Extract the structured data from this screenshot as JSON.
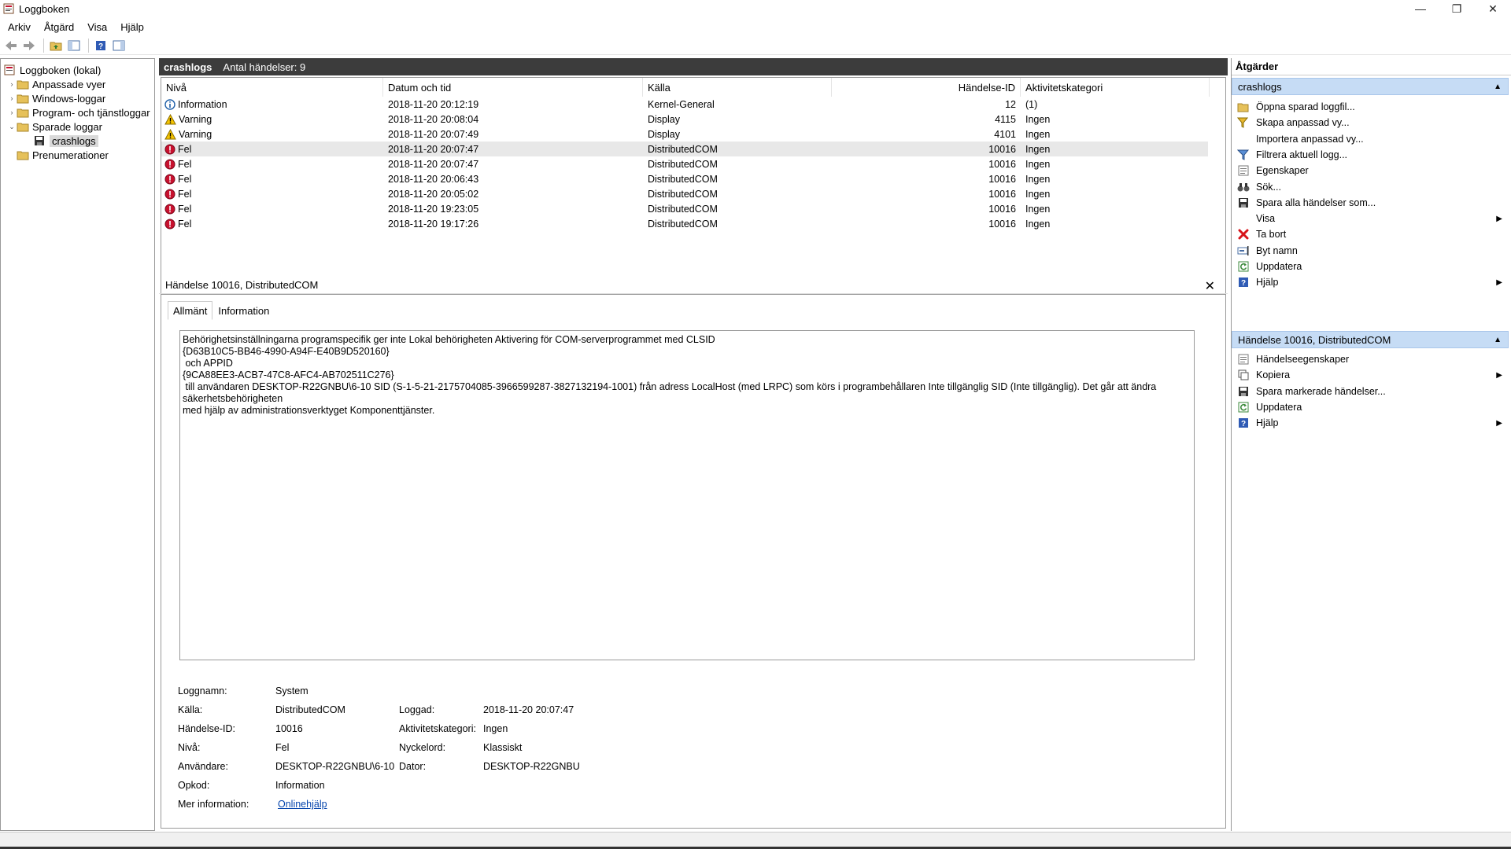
{
  "window": {
    "title": "Loggboken"
  },
  "menu": [
    "Arkiv",
    "Åtgärd",
    "Visa",
    "Hjälp"
  ],
  "tree": [
    {
      "label": "Loggboken (lokal)",
      "level": 0,
      "expander": "",
      "icon": "event-viewer-icon"
    },
    {
      "label": "Anpassade vyer",
      "level": 1,
      "expander": "›",
      "icon": "folder-icon"
    },
    {
      "label": "Windows-loggar",
      "level": 1,
      "expander": "›",
      "icon": "folder-icon"
    },
    {
      "label": "Program- och tjänstloggar",
      "level": 1,
      "expander": "›",
      "icon": "folder-icon"
    },
    {
      "label": "Sparade loggar",
      "level": 1,
      "expander": "⌄",
      "icon": "folder-icon"
    },
    {
      "label": "crashlogs",
      "level": 2,
      "expander": "",
      "icon": "saved-log-icon",
      "selected": true
    },
    {
      "label": "Prenumerationer",
      "level": 1,
      "expander": "",
      "icon": "folder-icon"
    }
  ],
  "list": {
    "name": "crashlogs",
    "count_label": "Antal händelser: 9",
    "columns": [
      "Nivå",
      "Datum och tid",
      "Källa",
      "Händelse-ID",
      "Aktivitetskategori"
    ],
    "rows": [
      {
        "level": "Information",
        "type": "info",
        "datetime": "2018-11-20 20:12:19",
        "source": "Kernel-General",
        "id": "12",
        "category": "(1)"
      },
      {
        "level": "Varning",
        "type": "warning",
        "datetime": "2018-11-20 20:08:04",
        "source": "Display",
        "id": "4115",
        "category": "Ingen"
      },
      {
        "level": "Varning",
        "type": "warning",
        "datetime": "2018-11-20 20:07:49",
        "source": "Display",
        "id": "4101",
        "category": "Ingen"
      },
      {
        "level": "Fel",
        "type": "error",
        "datetime": "2018-11-20 20:07:47",
        "source": "DistributedCOM",
        "id": "10016",
        "category": "Ingen",
        "selected": true
      },
      {
        "level": "Fel",
        "type": "error",
        "datetime": "2018-11-20 20:07:47",
        "source": "DistributedCOM",
        "id": "10016",
        "category": "Ingen"
      },
      {
        "level": "Fel",
        "type": "error",
        "datetime": "2018-11-20 20:06:43",
        "source": "DistributedCOM",
        "id": "10016",
        "category": "Ingen"
      },
      {
        "level": "Fel",
        "type": "error",
        "datetime": "2018-11-20 20:05:02",
        "source": "DistributedCOM",
        "id": "10016",
        "category": "Ingen"
      },
      {
        "level": "Fel",
        "type": "error",
        "datetime": "2018-11-20 19:23:05",
        "source": "DistributedCOM",
        "id": "10016",
        "category": "Ingen"
      },
      {
        "level": "Fel",
        "type": "error",
        "datetime": "2018-11-20 19:17:26",
        "source": "DistributedCOM",
        "id": "10016",
        "category": "Ingen"
      }
    ]
  },
  "detail": {
    "title": "Händelse 10016, DistributedCOM",
    "tabs": [
      "Allmänt",
      "Information"
    ],
    "message": [
      "Behörighetsinställningarna programspecifik ger inte Lokal behörigheten Aktivering för COM-serverprogrammet med CLSID",
      "{D63B10C5-BB46-4990-A94F-E40B9D520160}",
      " och APPID",
      "{9CA88EE3-ACB7-47C8-AFC4-AB702511C276}",
      " till användaren DESKTOP-R22GNBU\\6-10 SID (S-1-5-21-2175704085-3966599287-3827132194-1001) från adress LocalHost (med LRPC) som körs i programbehållaren Inte tillgänglig SID (Inte tillgänglig). Det går att ändra säkerhetsbehörigheten",
      "med hjälp av administrationsverktyget Komponenttjänster."
    ],
    "fields": {
      "logname_label": "Loggnamn:",
      "logname": "System",
      "source_label": "Källa:",
      "source": "DistributedCOM",
      "logged_label": "Loggad:",
      "logged": "2018-11-20 20:07:47",
      "eventid_label": "Händelse-ID:",
      "eventid": "10016",
      "category_label": "Aktivitetskategori:",
      "category": "Ingen",
      "level_label": "Nivå:",
      "level": "Fel",
      "keywords_label": "Nyckelord:",
      "keywords": "Klassiskt",
      "user_label": "Användare:",
      "user": "DESKTOP-R22GNBU\\6-10",
      "computer_label": "Dator:",
      "computer": "DESKTOP-R22GNBU",
      "opcode_label": "Opkod:",
      "opcode": "Information",
      "moreinfo_label": "Mer information:",
      "moreinfo_link": "Onlinehjälp"
    }
  },
  "actions": {
    "title": "Åtgärder",
    "section1": "crashlogs",
    "items1": [
      {
        "label": "Öppna sparad loggfil...",
        "icon": "open-folder-icon"
      },
      {
        "label": "Skapa anpassad vy...",
        "icon": "filter-add-icon"
      },
      {
        "label": "Importera anpassad vy...",
        "icon": ""
      },
      {
        "label": "Filtrera aktuell logg...",
        "icon": "filter-icon"
      },
      {
        "label": "Egenskaper",
        "icon": "properties-icon"
      },
      {
        "label": "Sök...",
        "icon": "binoculars-icon"
      },
      {
        "label": "Spara alla händelser som...",
        "icon": "save-icon"
      },
      {
        "label": "Visa",
        "icon": "",
        "submenu": true
      },
      {
        "label": "Ta bort",
        "icon": "delete-icon"
      },
      {
        "label": "Byt namn",
        "icon": "rename-icon"
      },
      {
        "label": "Uppdatera",
        "icon": "refresh-icon"
      },
      {
        "label": "Hjälp",
        "icon": "help-icon",
        "submenu": true
      }
    ],
    "section2": "Händelse 10016, DistributedCOM",
    "items2": [
      {
        "label": "Händelseegenskaper",
        "icon": "properties-icon"
      },
      {
        "label": "Kopiera",
        "icon": "copy-icon",
        "submenu": true
      },
      {
        "label": "Spara markerade händelser...",
        "icon": "save-icon"
      },
      {
        "label": "Uppdatera",
        "icon": "refresh-icon"
      },
      {
        "label": "Hjälp",
        "icon": "help-icon",
        "submenu": true
      }
    ]
  },
  "colors": {
    "section_bg": "#c6dcf5",
    "list_header_bg": "#3c3c3c",
    "error": "#c8102e",
    "warning": "#f5c400",
    "info": "#1f5fa8"
  }
}
